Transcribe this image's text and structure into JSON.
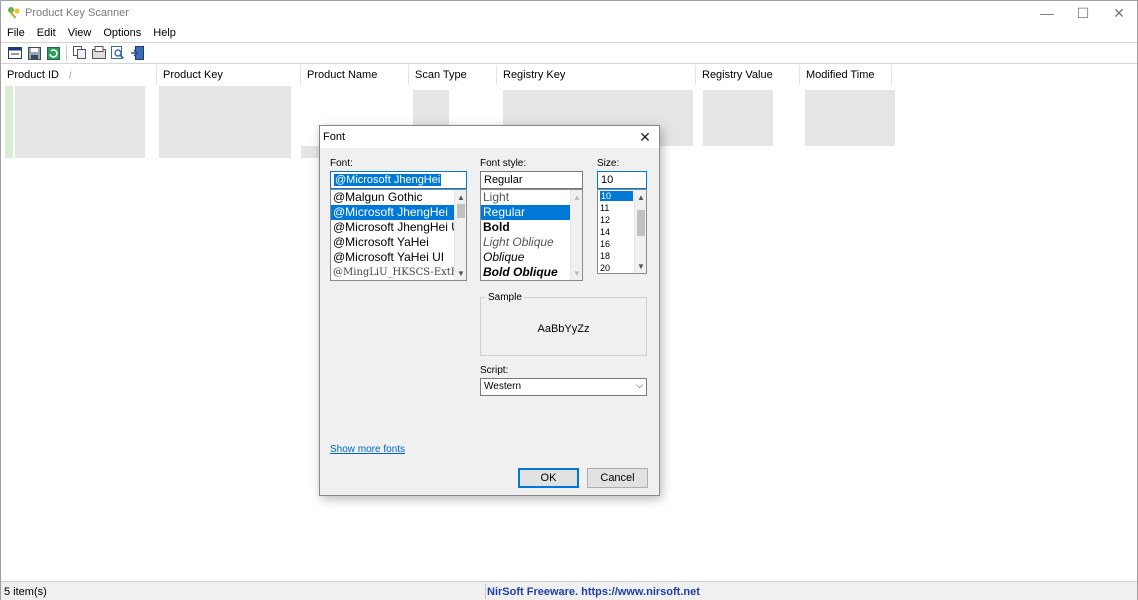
{
  "window": {
    "title": "Product Key Scanner",
    "controls": {
      "minimize": "—",
      "maximize": "☐",
      "close": "✕"
    }
  },
  "menu": [
    "File",
    "Edit",
    "View",
    "Options",
    "Help"
  ],
  "toolbar": [
    "properties-icon",
    "save-icon",
    "refresh-icon",
    "copy-icon",
    "html-report-icon",
    "find-icon",
    "exit-icon"
  ],
  "columns": [
    "Product ID",
    "Product Key",
    "Product Name",
    "Scan Type",
    "Registry Key",
    "Registry Value",
    "Modified Time"
  ],
  "sort_indicator": "/",
  "status": {
    "items": "5 item(s)",
    "link": "NirSoft Freeware. https://www.nirsoft.net"
  },
  "dialog": {
    "title": "Font",
    "close": "✕",
    "font_label": "Font:",
    "font_value": "@Microsoft JhengHei",
    "fonts": [
      "@Malgun Gothic",
      "@Microsoft JhengHei",
      "@Microsoft JhengHei UI",
      "@Microsoft YaHei",
      "@Microsoft YaHei UI",
      "@MingLiU_HKSCS-ExtB"
    ],
    "style_label": "Font style:",
    "style_value": "Regular",
    "styles": [
      "Light",
      "Regular",
      "Bold",
      "Light Oblique",
      "Oblique",
      "Bold Oblique"
    ],
    "size_label": "Size:",
    "size_value": "10",
    "sizes": [
      "10",
      "11",
      "12",
      "14",
      "16",
      "18",
      "20"
    ],
    "sample_label": "Sample",
    "sample_text": "AaBbYyZz",
    "script_label": "Script:",
    "script_value": "Western",
    "more_fonts": "Show more fonts",
    "ok": "OK",
    "cancel": "Cancel"
  }
}
